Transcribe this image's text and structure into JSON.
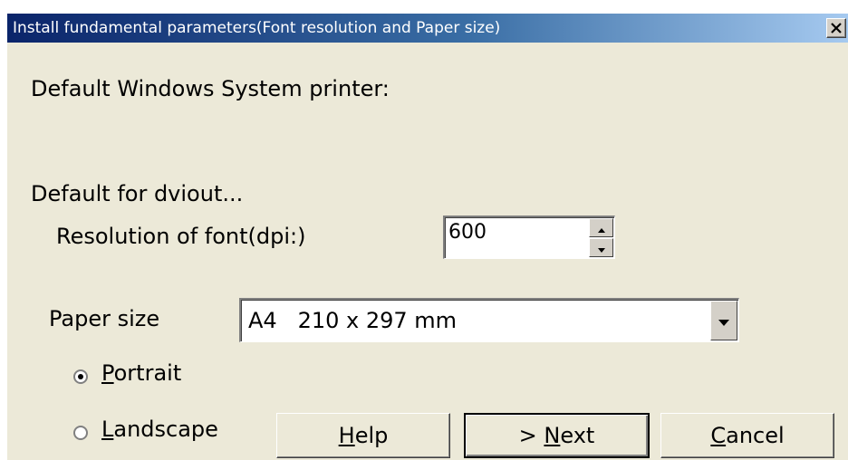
{
  "window": {
    "title": "Install fundamental parameters(Font resolution and Paper size)",
    "close_icon": "close-icon"
  },
  "labels": {
    "default_printer": "Default Windows System printer:",
    "default_for": "Default for dviout...",
    "resolution": "Resolution of font(dpi:)",
    "paper_size": "Paper size"
  },
  "resolution": {
    "value": "600"
  },
  "paper": {
    "selected": "A4   210 x 297 mm"
  },
  "orientation": {
    "portrait": {
      "accel": "P",
      "rest": "ortrait",
      "checked": true
    },
    "landscape": {
      "accel": "L",
      "rest": "andscape",
      "checked": false
    }
  },
  "buttons": {
    "help": {
      "accel": "H",
      "rest": "elp"
    },
    "next": {
      "prefix": "> ",
      "accel": "N",
      "rest": "ext"
    },
    "cancel": {
      "accel": "C",
      "rest": "ancel"
    }
  }
}
